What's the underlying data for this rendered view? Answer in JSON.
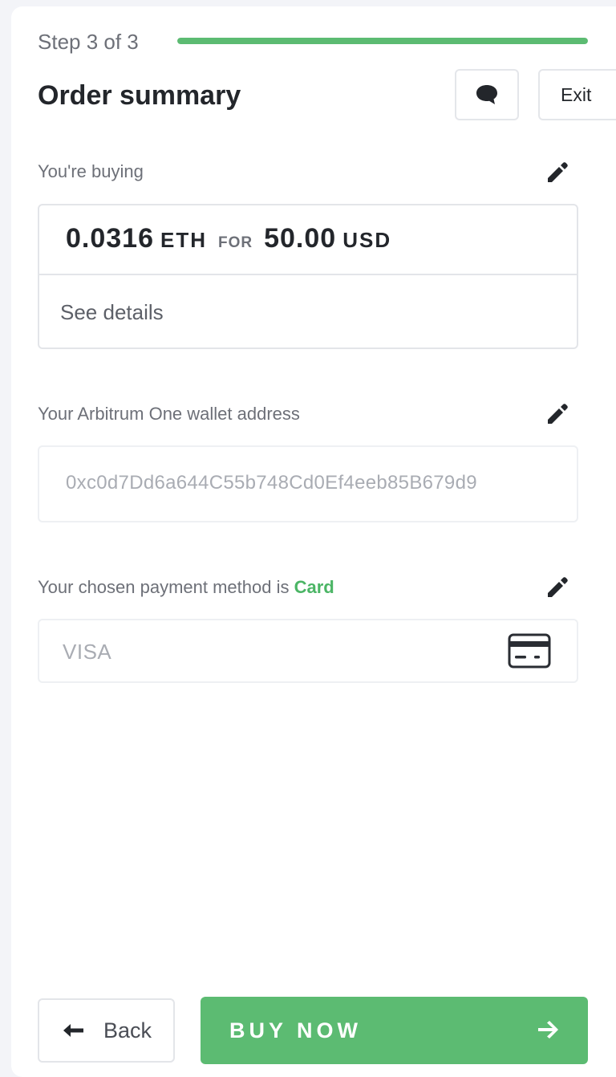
{
  "header": {
    "step_label": "Step 3 of 3",
    "progress": 1.0,
    "title": "Order summary",
    "exit_label": "Exit"
  },
  "buying": {
    "label": "You're buying",
    "crypto_amount": "0.0316",
    "crypto_currency": "ETH",
    "for_label": "FOR",
    "fiat_amount": "50.00",
    "fiat_currency": "USD",
    "see_details": "See details"
  },
  "wallet": {
    "label": "Your Arbitrum One wallet address",
    "address": "0xc0d7Dd6a644C55b748Cd0Ef4eeb85B679d9"
  },
  "payment": {
    "label_prefix": "Your chosen payment method is",
    "method": "Card",
    "card_brand": "VISA"
  },
  "footer": {
    "back_label": "Back",
    "buy_label": "BUY NOW"
  },
  "colors": {
    "accent": "#5cbb72",
    "text": "#23262b",
    "muted": "#6d7078"
  },
  "icons": [
    "chat-icon",
    "pencil-icon",
    "credit-card-icon",
    "arrow-left-icon",
    "arrow-right-icon"
  ]
}
